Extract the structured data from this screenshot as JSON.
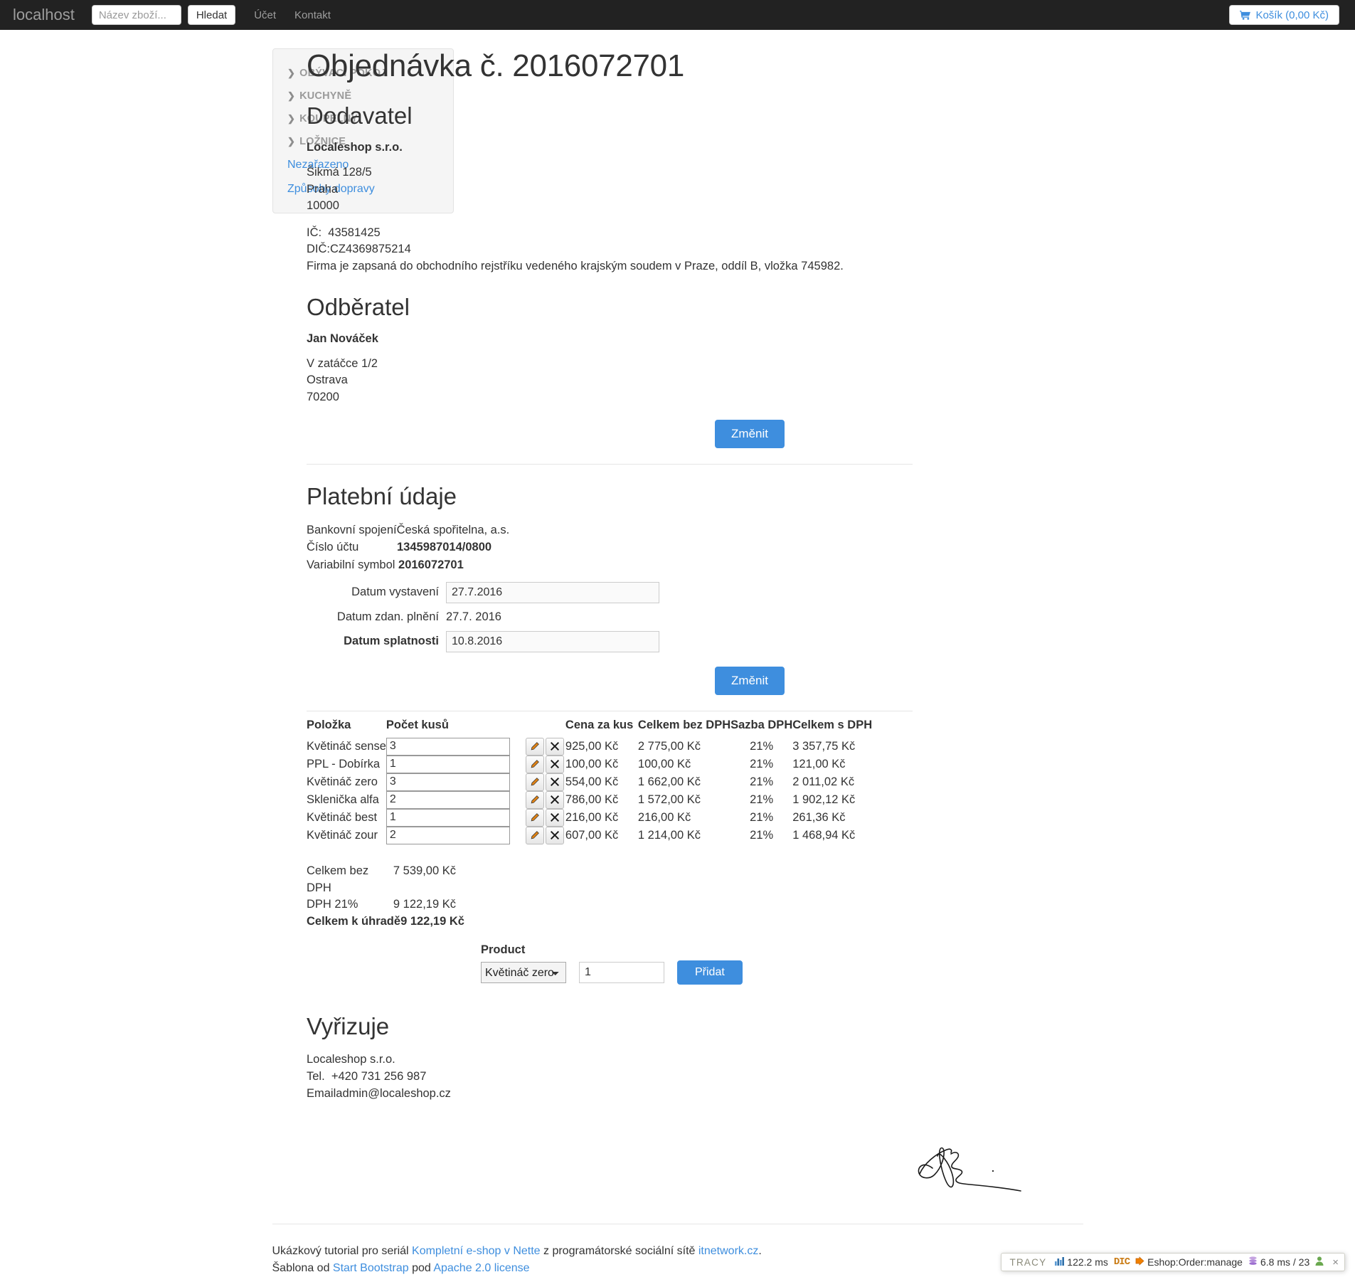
{
  "navbar": {
    "brand": "localhost",
    "search_placeholder": "Název zboží...",
    "search_value": "",
    "search_button": "Hledat",
    "links": [
      {
        "label": "Účet"
      },
      {
        "label": "Kontakt"
      }
    ],
    "cart_label": "Košík (0,00 Kč)",
    "cart_icon": "shopping-cart-icon"
  },
  "sidebar": {
    "categories": [
      {
        "label": "OBÝVACÍ POKOJ",
        "icon": "chevron-down-icon"
      },
      {
        "label": "KUCHYNĚ",
        "icon": "chevron-down-icon"
      },
      {
        "label": "KOUPELNY",
        "icon": "chevron-down-icon"
      },
      {
        "label": "LOŽNICE",
        "icon": "chevron-down-icon"
      }
    ],
    "links": [
      {
        "label": "Nezařazeno"
      },
      {
        "label": "Způsoby dopravy"
      }
    ]
  },
  "order": {
    "title": "Objednávka č. 2016072701",
    "supplier": {
      "heading": "Dodavatel",
      "name": "Localeshop s.r.o.",
      "street": "Šikmá 128/5",
      "city": "Praha",
      "zip": "10000",
      "ico_label": "IČ:",
      "ico_value": "43581425",
      "dic_label": "DIČ:",
      "dic_value": "CZ4369875214",
      "registry": "Firma je zapsaná do obchodního rejstříku vedeného krajským soudem v Praze, oddíl B, vložka 745982."
    },
    "customer": {
      "heading": "Odběratel",
      "name": "Jan Nováček",
      "street": "V zatáčce 1/2",
      "city": "Ostrava",
      "zip": "70200",
      "change_button": "Změnit"
    },
    "payment": {
      "heading": "Platební údaje",
      "bank_label": "Bankovní spojení",
      "bank_value": "Česká spořitelna, a.s.",
      "account_label": "Číslo účtu",
      "account_value": "1345987014/0800",
      "vs_label": "Variabilní symbol",
      "vs_value": "2016072701",
      "issue_date_label": "Datum vystavení",
      "issue_date_value": "27.7.2016",
      "taxable_date_label": "Datum zdan. plnění",
      "taxable_date_value": "27.7. 2016",
      "due_date_label": "Datum splatnosti",
      "due_date_value": "10.8.2016",
      "change_button": "Změnit"
    },
    "items_table": {
      "columns": [
        "Položka",
        "Počet kusů",
        "Cena za kus",
        "Celkem bez DPH",
        "Sazba DPH",
        "Celkem s DPH"
      ],
      "rows": [
        {
          "name": "Květináč sense",
          "qty": "3",
          "unit_price": "925,00 Kč",
          "total_no_vat": "2 775,00 Kč",
          "vat_rate": "21%",
          "total_with_vat": "3 357,75 Kč"
        },
        {
          "name": "PPL - Dobírka",
          "qty": "1",
          "unit_price": "100,00 Kč",
          "total_no_vat": "100,00 Kč",
          "vat_rate": "21%",
          "total_with_vat": "121,00 Kč"
        },
        {
          "name": "Květináč zero",
          "qty": "3",
          "unit_price": "554,00 Kč",
          "total_no_vat": "1 662,00 Kč",
          "vat_rate": "21%",
          "total_with_vat": "2 011,02 Kč"
        },
        {
          "name": "Sklenička alfa",
          "qty": "2",
          "unit_price": "786,00 Kč",
          "total_no_vat": "1 572,00 Kč",
          "vat_rate": "21%",
          "total_with_vat": "1 902,12 Kč"
        },
        {
          "name": "Květináč best",
          "qty": "1",
          "unit_price": "216,00 Kč",
          "total_no_vat": "216,00 Kč",
          "vat_rate": "21%",
          "total_with_vat": "261,36 Kč"
        },
        {
          "name": "Květináč zour",
          "qty": "2",
          "unit_price": "607,00 Kč",
          "total_no_vat": "1 214,00 Kč",
          "vat_rate": "21%",
          "total_with_vat": "1 468,94 Kč"
        }
      ],
      "edit_icon": "pencil-icon",
      "delete_icon": "close-x-icon"
    },
    "totals": {
      "subtotal_label": "Celkem bez DPH",
      "subtotal_value": "7 539,00 Kč",
      "vat_label": "DPH 21%",
      "vat_value": "9 122,19 Kč",
      "grand_label": "Celkem k úhradě",
      "grand_value": "9 122,19 Kč"
    },
    "add_product": {
      "label": "Product",
      "selected_product": "Květináč zero",
      "options": [
        "Květináč zero"
      ],
      "quantity": "1",
      "button": "Přidat"
    },
    "handler": {
      "heading": "Vyřizuje",
      "company": "Localeshop s.r.o.",
      "tel_label": "Tel.",
      "tel_value": "+420 731 256 987",
      "email_label": "Email",
      "email_value": "admin@localeshop.cz",
      "signature": "handwritten-signature"
    }
  },
  "footer": {
    "line1_pre": "Ukázkový tutorial pro seriál ",
    "line1_link1": "Kompletní e-shop v Nette",
    "line1_mid": " z programátorské sociální sítě ",
    "line1_link2": "itnetwork.cz",
    "line1_post": ".",
    "line2_pre": "Šablona od ",
    "line2_link1": "Start Bootstrap",
    "line2_mid": " pod ",
    "line2_link2": "Apache 2.0 license"
  },
  "tracy": {
    "label": "TRACY",
    "time": "122.2 ms",
    "dic_label": "DIC",
    "route": "Eshop:Order:manage",
    "db": "6.8 ms / 23",
    "close": "×",
    "icons": {
      "bar_chart": "bar-chart-icon",
      "dic": "dependency-injection-icon",
      "arrow": "arrow-right-icon",
      "database": "database-icon",
      "user": "user-icon"
    }
  },
  "colors": {
    "navbar_bg": "#222222",
    "accent": "#3e8ede",
    "sidebar_bg": "#f5f5f5",
    "muted": "#9d9d9d"
  }
}
